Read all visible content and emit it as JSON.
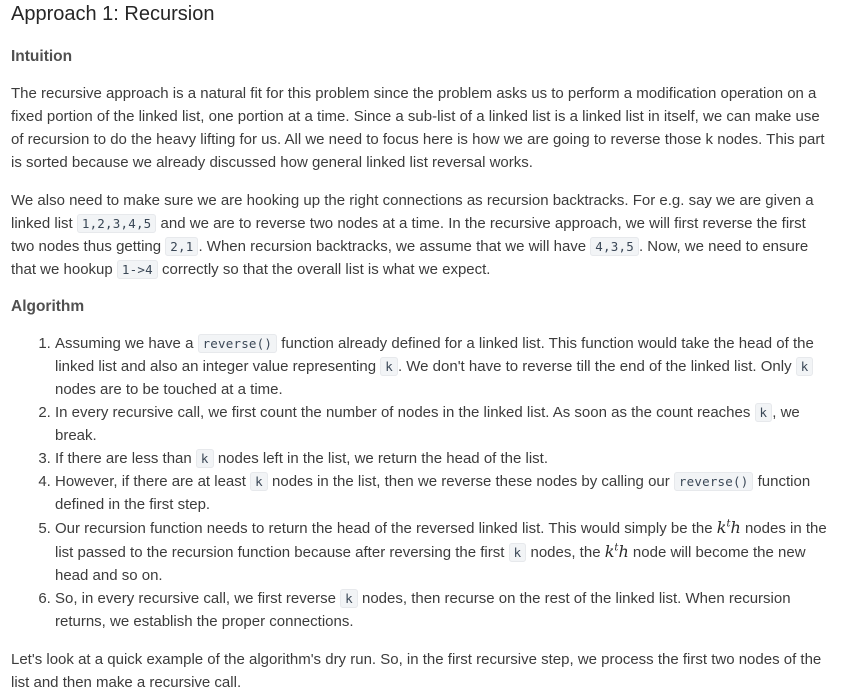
{
  "title": "Approach 1: Recursion",
  "intuition": {
    "heading": "Intuition",
    "p1": "The recursive approach is a natural fit for this problem since the problem asks us to perform a modification operation on a fixed portion of the linked list, one portion at a time. Since a sub-list of a linked list is a linked list in itself, we can make use of recursion to do the heavy lifting for us. All we need to focus here is how we are going to reverse those k nodes. This part is sorted because we already discussed how general linked list reversal works.",
    "p2": {
      "t1": "We also need to make sure we are hooking up the right connections as recursion backtracks. For e.g. say we are given a linked list ",
      "c1": "1,2,3,4,5",
      "t2": " and we are to reverse two nodes at a time. In the recursive approach, we will first reverse the first two nodes thus getting ",
      "c2": "2,1",
      "t3": ". When recursion backtracks, we assume that we will have ",
      "c3": "4,3,5",
      "t4": ". Now, we need to ensure that we hookup ",
      "c4": "1->4",
      "t5": " correctly so that the overall list is what we expect."
    }
  },
  "algorithm": {
    "heading": "Algorithm",
    "steps": [
      {
        "t1": "Assuming we have a ",
        "c1": "reverse()",
        "t2": " function already defined for a linked list. This function would take the head of the linked list and also an integer value representing ",
        "c2": "k",
        "t3": ". We don't have to reverse till the end of the linked list. Only ",
        "c3": "k",
        "t4": " nodes are to be touched at a time."
      },
      {
        "t1": "In every recursive call, we first count the number of nodes in the linked list. As soon as the count reaches ",
        "c1": "k",
        "t2": ", we break."
      },
      {
        "t1": "If there are less than ",
        "c1": "k",
        "t2": " nodes left in the list, we return the head of the list."
      },
      {
        "t1": "However, if there are at least ",
        "c1": "k",
        "t2": " nodes in the list, then we reverse these nodes by calling our ",
        "c2": "reverse()",
        "t3": " function defined in the first step."
      },
      {
        "t1": "Our recursion function needs to return the head of the reversed linked list. This would simply be the ",
        "m1_base": "k",
        "m1_sup": "t",
        "m1_tail": "h",
        "t2": " nodes in the list passed to the recursion function because after reversing the first ",
        "c1": "k",
        "t3": " nodes, the ",
        "m2_base": "k",
        "m2_sup": "t",
        "m2_tail": "h",
        "t4": " node will become the new head and so on."
      },
      {
        "t1": "So, in every recursive call, we first reverse ",
        "c1": "k",
        "t2": " nodes, then recurse on the rest of the linked list. When recursion returns, we establish the proper connections."
      }
    ]
  },
  "closing": "Let's look at a quick example of the algorithm's dry run. So, in the first recursive step, we process the first two nodes of the list and then make a recursive call."
}
